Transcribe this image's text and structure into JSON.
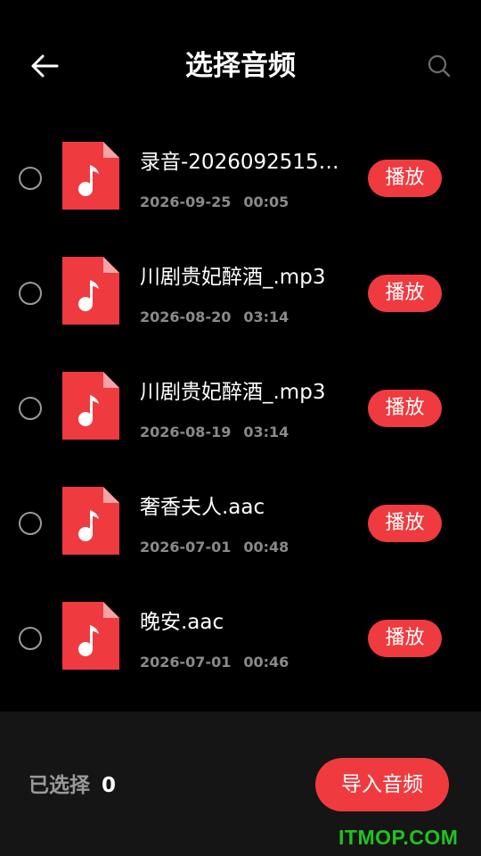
{
  "header": {
    "title": "选择音频",
    "back_icon": "arrow-left-icon",
    "search_icon": "search-icon"
  },
  "files": [
    {
      "name": "录音-20260925153…",
      "date": "2026-09-25",
      "duration": "00:05",
      "play_label": "播放"
    },
    {
      "name": "川剧贵妃醉酒_.mp3",
      "date": "2026-08-20",
      "duration": "03:14",
      "play_label": "播放"
    },
    {
      "name": "川剧贵妃醉酒_.mp3",
      "date": "2026-08-19",
      "duration": "03:14",
      "play_label": "播放"
    },
    {
      "name": "奢香夫人.aac",
      "date": "2026-07-01",
      "duration": "00:48",
      "play_label": "播放"
    },
    {
      "name": "晚安.aac",
      "date": "2026-07-01",
      "duration": "00:46",
      "play_label": "播放"
    }
  ],
  "footer": {
    "selected_label": "已选择",
    "selected_count": "0",
    "import_label": "导入音频"
  },
  "watermark": "ITMOP.COM",
  "colors": {
    "accent": "#ef3b3f",
    "background": "#000000",
    "footer_bg": "#151515",
    "muted_text": "#8a8a8a",
    "watermark": "#22c21f"
  }
}
